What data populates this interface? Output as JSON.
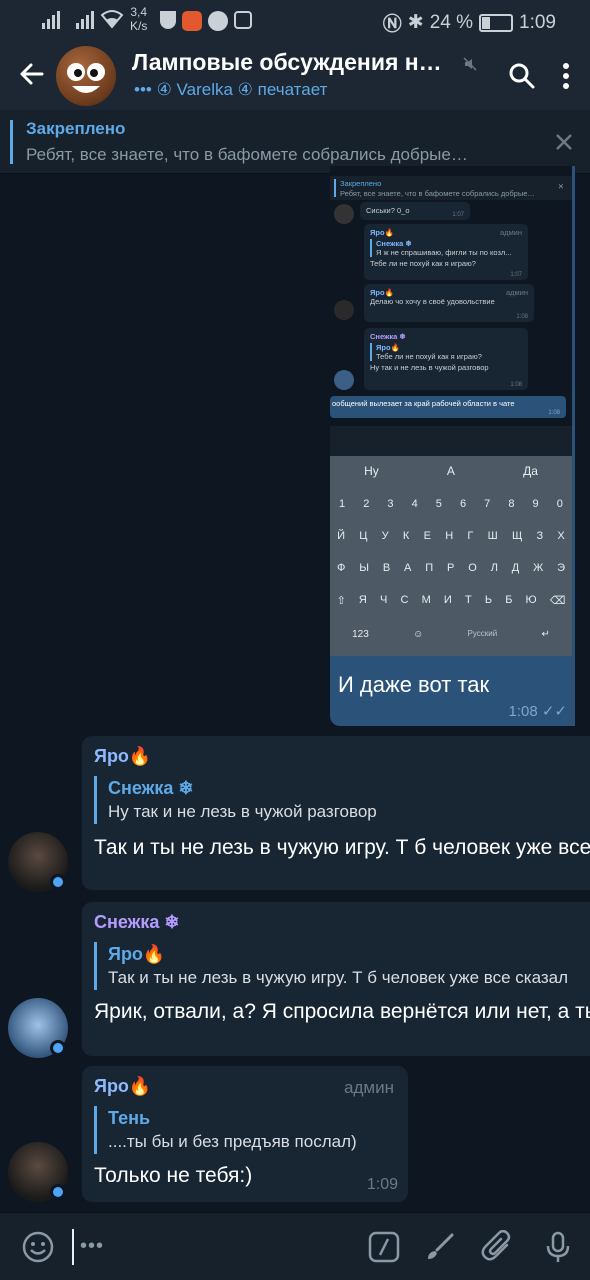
{
  "status_bar": {
    "speed_value": "3,4",
    "speed_unit": "K/s",
    "battery": "24 %",
    "time": "1:09"
  },
  "header": {
    "title": "Ламповые обсуждения н…",
    "subtitle_icons": "•••",
    "subtitle": "④ Varelka ④ печатает"
  },
  "pinned": {
    "label": "Закреплено",
    "text": "Ребят, все знаете, что в бафомете собрались добрые…"
  },
  "outgoing": {
    "screenshot": {
      "pinned_label": "Закреплено",
      "pinned_text": "Ребят, все знаете, что в бафомете собрались добрые…",
      "msg1_text": "Сиськи? 0_о",
      "msg1_time": "1:07",
      "msg2_name": "Яро🔥",
      "msg2_admin": "админ",
      "msg2_quote_name": "Снежка ❄",
      "msg2_quote_text": "Я ж не спрашиваю, фигли ты по козл...",
      "msg2_text": "Тебе ли не похуй как я играю?",
      "msg2_time": "1:07",
      "msg3_name": "Яро🔥",
      "msg3_admin": "админ",
      "msg3_text": "Делаю чо хочу в своё удовольствие",
      "msg3_time": "1:08",
      "msg4_name": "Снежка ❄",
      "msg4_quote_name": "Яро🔥",
      "msg4_quote_text": "Тебе ли не похуй как я играю?",
      "msg4_text": "Ну так и не лезь в чужой разговор",
      "msg4_time": "1:08",
      "msg5_text": "ообщений вылезает за край рабочей области в чате",
      "msg5_time": "1:08",
      "kb_suggest": [
        "Ну",
        "А",
        "Да"
      ],
      "kb_rows": [
        [
          "1",
          "2",
          "3",
          "4",
          "5",
          "6",
          "7",
          "8",
          "9",
          "0"
        ],
        [
          "Й",
          "Ц",
          "У",
          "К",
          "Е",
          "Н",
          "Г",
          "Ш",
          "Щ",
          "З",
          "Х"
        ],
        [
          "Ф",
          "Ы",
          "В",
          "А",
          "П",
          "Р",
          "О",
          "Л",
          "Д",
          "Ж",
          "Э"
        ],
        [
          "⇧",
          "Я",
          "Ч",
          "С",
          "М",
          "И",
          "Т",
          "Ь",
          "Б",
          "Ю",
          "⌫"
        ]
      ],
      "kb_num": "123",
      "kb_lang": "Русский"
    },
    "text": "И даже вот так",
    "time": "1:08"
  },
  "messages": [
    {
      "name": "Яро🔥",
      "name_color": "#8fb8ff",
      "quote_name": "Снежка ❄",
      "quote_text": "Ну так и не лезь в чужой разговор",
      "text": "Так и ты не лезь в чужую игру. Т б человек уже все сказал"
    },
    {
      "name": "Снежка ❄",
      "name_color": "#b49cff",
      "quote_name": "Яро🔥",
      "quote_text": "Так и ты не лезь в чужую игру. Т б человек уже все сказал",
      "text": "Ярик, отвали, а? Я спросила вернётся или нет, а ты"
    },
    {
      "name": "Яро🔥",
      "name_color": "#8fb8ff",
      "admin": "админ",
      "quote_name": "Тень",
      "quote_text": "....ты бы и без предъяв послал)",
      "text": "Только не тебя:)",
      "time": "1:09"
    }
  ],
  "colors": {
    "background": "#0e1621",
    "header": "#1c2733",
    "bubble_in": "#182533",
    "bubble_out": "#2b5278",
    "accent": "#5fa9e6"
  }
}
